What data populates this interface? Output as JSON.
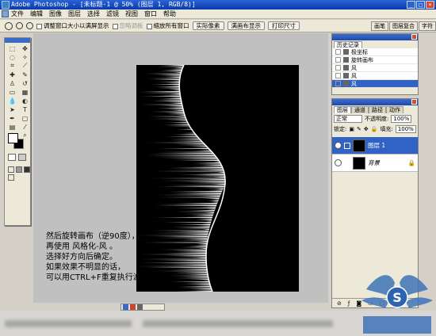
{
  "window": {
    "title": "Adobe Photoshop - [未标题-1 @ 50% (图层 1, RGB/8)]"
  },
  "menu": [
    "文件",
    "编辑",
    "图像",
    "图层",
    "选择",
    "滤镜",
    "视图",
    "窗口",
    "帮助"
  ],
  "options": {
    "resize_windows": "调整窗口大小以满屏显示",
    "ignore_palettes": "忽略调板",
    "zoom_all": "缩放所有窗口",
    "actual_pixels": "实际像素",
    "fit_screen": "满画布显示",
    "print_size": "打印尺寸"
  },
  "palette_well": [
    "画笔",
    "图层复合",
    "字符"
  ],
  "history": {
    "tab": "历史记录",
    "items": [
      "极坐标",
      "旋转画布",
      "风",
      "风",
      "风"
    ],
    "selected_index": 4
  },
  "layers": {
    "tabs": [
      "图层",
      "通道",
      "路径",
      "动作"
    ],
    "blend_mode": "正常",
    "opacity_label": "不透明度:",
    "opacity_value": "100%",
    "lock_label": "锁定:",
    "fill_label": "填充:",
    "fill_value": "100%",
    "rows": [
      {
        "name": "图层 1",
        "selected": true
      },
      {
        "name": "背景",
        "selected": false
      }
    ]
  },
  "caption": {
    "lines": [
      "然后旋转画布（逆90度），",
      "再使用 风格化-风 。",
      "选择好方向后确定。",
      "如果效果不明显的话，",
      "可以用CTRL+F重复执行滤镜。"
    ]
  },
  "colors": {
    "title_blue": "#0a3aa8",
    "selection": "#3163c6",
    "canvas_grey": "#c0c0c0"
  },
  "icons": [
    "photoshop-icon",
    "zoom-icon",
    "eye-icon",
    "lock-icon",
    "brush-icon",
    "close-icon",
    "watermark-logo"
  ]
}
